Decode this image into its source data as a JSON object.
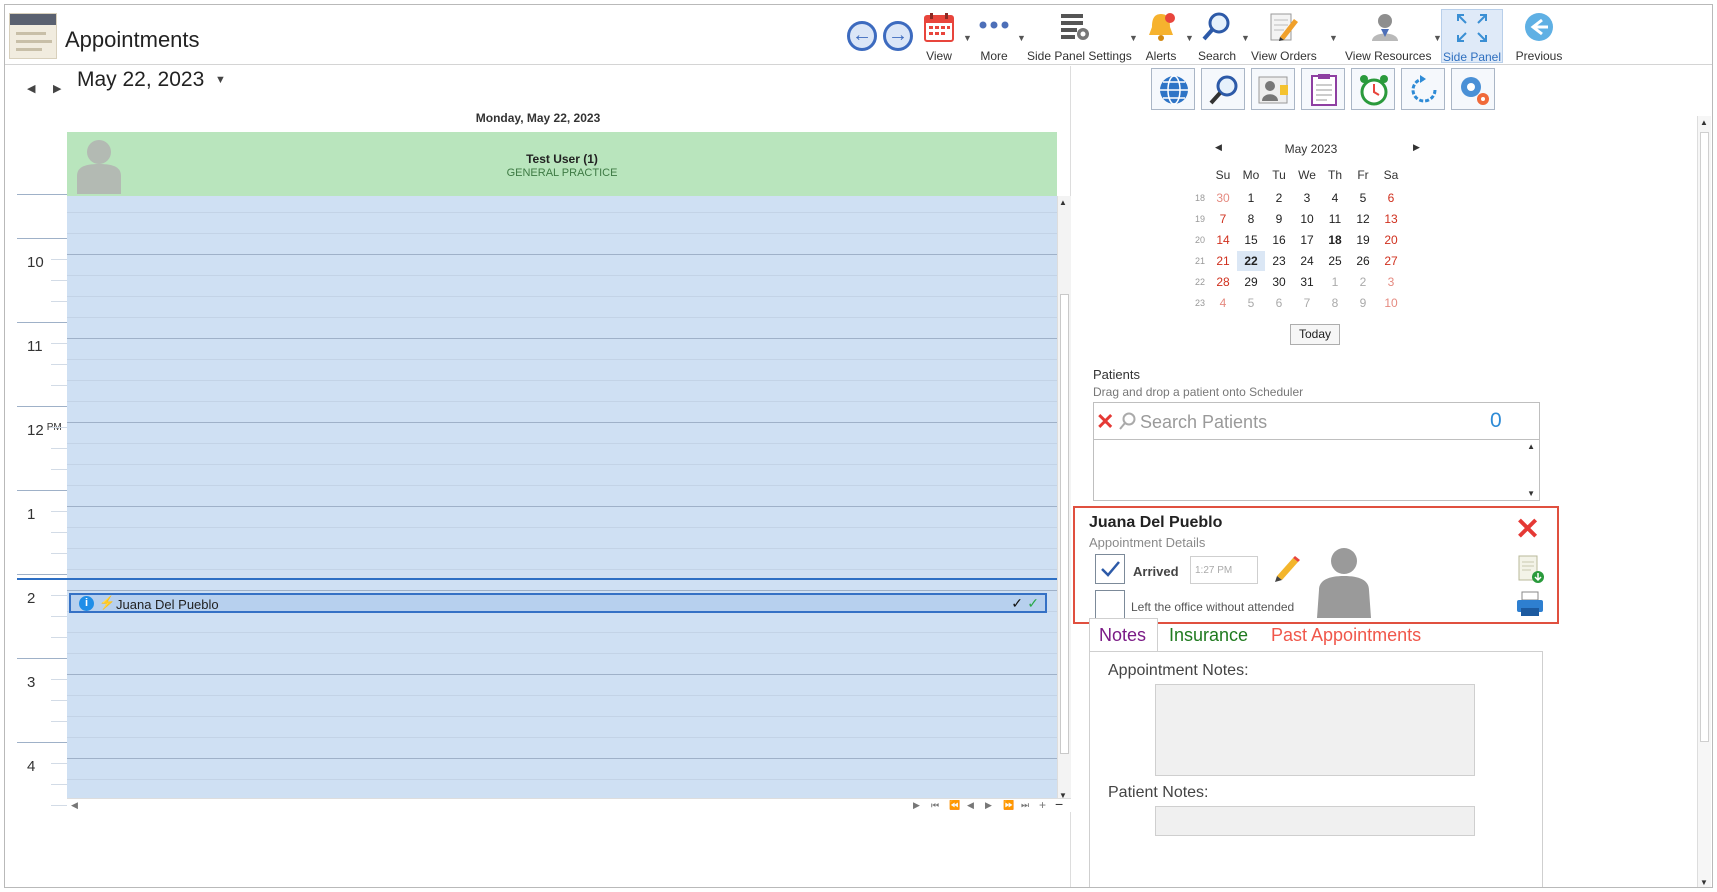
{
  "app": {
    "title": "Appointments"
  },
  "toolbar": {
    "back_icon": "arrow-left-circle-icon",
    "forward_icon": "arrow-right-circle-icon",
    "items": [
      {
        "label": "View",
        "icon": "calendar-icon"
      },
      {
        "label": "More",
        "icon": "more-dots-icon"
      },
      {
        "label": "Side Panel Settings",
        "icon": "side-panel-settings-icon"
      },
      {
        "label": "Alerts",
        "icon": "bell-icon"
      },
      {
        "label": "Search",
        "icon": "search-icon"
      },
      {
        "label": "View Orders",
        "icon": "orders-icon"
      },
      {
        "label": "View Resources",
        "icon": "resources-icon"
      },
      {
        "label": "Side Panel",
        "icon": "expand-icon",
        "active": true
      },
      {
        "label": "Previous",
        "icon": "previous-icon"
      }
    ]
  },
  "scheduler": {
    "date": "May 22, 2023",
    "day_header": "Monday, May 22, 2023",
    "resource": {
      "name": "Test User (1)",
      "practice": "GENERAL PRACTICE"
    },
    "hours": [
      "10",
      "11",
      "12",
      "1",
      "2",
      "3",
      "4"
    ],
    "pm_marker": "PM",
    "appointment": {
      "patient": "Juana Del Pueblo"
    }
  },
  "side_panel": {
    "tools": [
      "globe-icon",
      "magnify-icon",
      "patient-card-icon",
      "clipboard-icon",
      "alarm-clock-icon",
      "refresh-icon",
      "settings-gears-icon"
    ],
    "calendar": {
      "title": "May 2023",
      "dow": [
        "Su",
        "Mo",
        "Tu",
        "We",
        "Th",
        "Fr",
        "Sa"
      ],
      "weeks": [
        {
          "wk": "18",
          "days": [
            "30",
            "1",
            "2",
            "3",
            "4",
            "5",
            "6"
          ]
        },
        {
          "wk": "19",
          "days": [
            "7",
            "8",
            "9",
            "10",
            "11",
            "12",
            "13"
          ]
        },
        {
          "wk": "20",
          "days": [
            "14",
            "15",
            "16",
            "17",
            "18",
            "19",
            "20"
          ]
        },
        {
          "wk": "21",
          "days": [
            "21",
            "22",
            "23",
            "24",
            "25",
            "26",
            "27"
          ]
        },
        {
          "wk": "22",
          "days": [
            "28",
            "29",
            "30",
            "31",
            "1",
            "2",
            "3"
          ]
        },
        {
          "wk": "23",
          "days": [
            "4",
            "5",
            "6",
            "7",
            "8",
            "9",
            "10"
          ]
        }
      ],
      "selected": "22",
      "today": "18",
      "today_button": "Today"
    },
    "patients": {
      "label": "Patients",
      "hint": "Drag and drop a patient onto Scheduler",
      "search_placeholder": "Search Patients",
      "count": "0"
    },
    "details": {
      "name": "Juana Del Pueblo",
      "subtitle": "Appointment Details",
      "arrived_label": "Arrived",
      "arrived_checked": true,
      "arrived_time": "1:27 PM",
      "left_label": "Left the office without attended",
      "left_checked": false
    },
    "tabs": [
      {
        "label": "Notes",
        "color": "#7b1a86"
      },
      {
        "label": "Insurance",
        "color": "#1f7a1f"
      },
      {
        "label": "Past Appointments",
        "color": "#f0574b"
      }
    ],
    "notes": {
      "appointment_label": "Appointment Notes:",
      "patient_label": "Patient Notes:"
    }
  }
}
